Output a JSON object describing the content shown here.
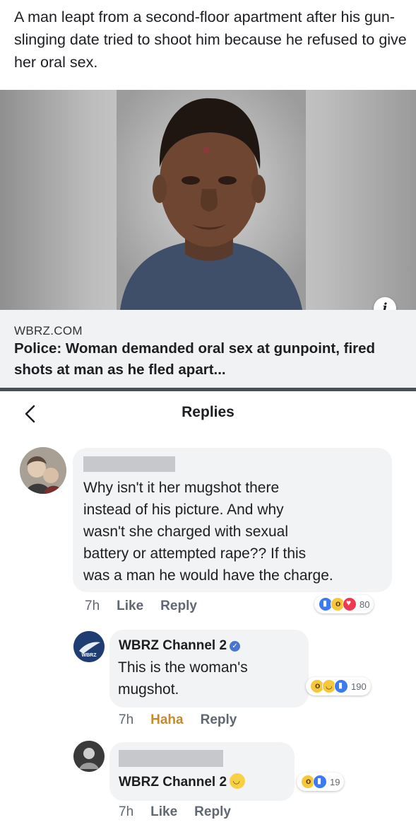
{
  "headline": "A man leapt from a second-floor apartment after his gun-slinging date tried to shoot him because he refused to give her oral sex.",
  "link_preview": {
    "domain": "WBRZ.COM",
    "title": "Police: Woman demanded oral sex at gunpoint, fired shots at man as he fled apart...",
    "info_icon": "info-icon"
  },
  "nav": {
    "back_icon": "chevron-left-icon",
    "title": "Replies"
  },
  "comments": [
    {
      "author": "",
      "text_lines": [
        "Why isn't it her mugshot there",
        "instead of his picture. And why",
        "wasn't she charged with sexual",
        "battery or attempted rape?? If this",
        "was a man he would have the charge."
      ],
      "time": "7h",
      "action": "Like",
      "reply": "Reply",
      "reaction_icons": [
        "like-icon",
        "wow-icon",
        "love-icon"
      ],
      "reaction_count": "80"
    },
    {
      "author": "WBRZ Channel 2",
      "verified": true,
      "text_lines": [
        "This is the woman's",
        "mugshot."
      ],
      "time": "7h",
      "action": "Haha",
      "reply": "Reply",
      "reaction_icons": [
        "wow-icon",
        "haha-icon",
        "like-icon"
      ],
      "reaction_count": "190"
    },
    {
      "author": "",
      "text_lines": [
        "WBRZ Channel 2"
      ],
      "time": "7h",
      "action": "Like",
      "reply": "Reply",
      "reaction_icons": [
        "wow-icon",
        "like-icon"
      ],
      "reaction_count": "19"
    }
  ],
  "colors": {
    "accent_blue": "#3b7af0",
    "haha_gold": "#c98a25",
    "bubble_bg": "#f2f3f5"
  }
}
